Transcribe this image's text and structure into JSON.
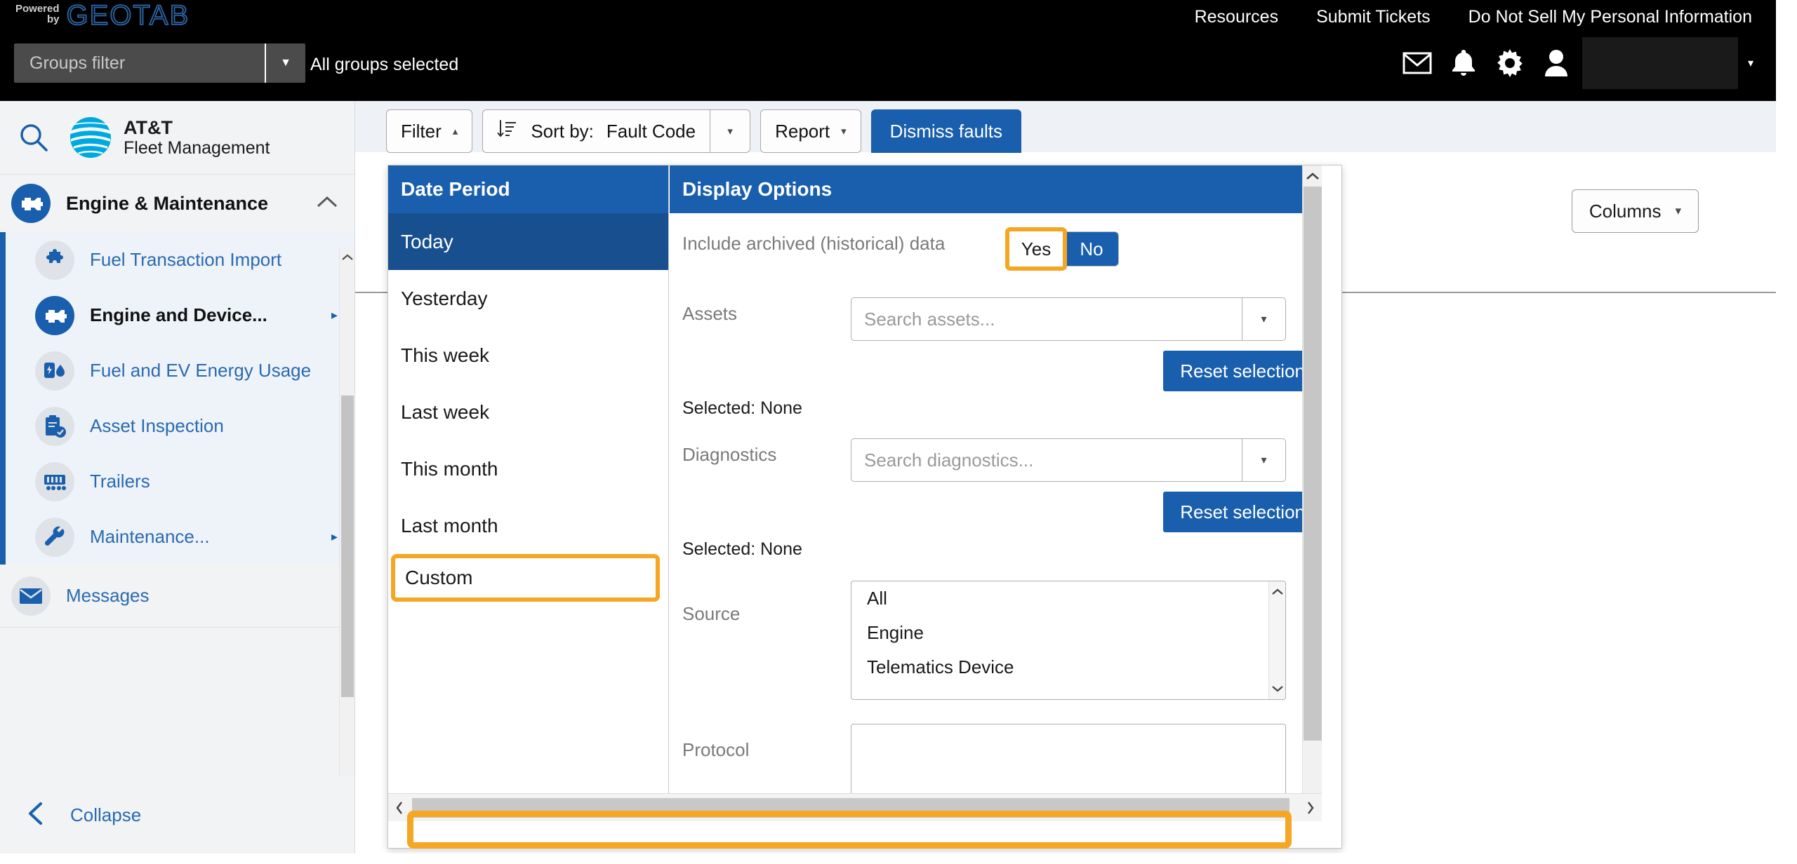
{
  "topbar": {
    "powered_line1": "Powered",
    "powered_line2": "by",
    "brand": "GEOTAB",
    "groups_filter_placeholder": "Groups filter",
    "groups_status": "All groups selected",
    "links": [
      {
        "label": "Resources",
        "name": "resources-link"
      },
      {
        "label": "Submit Tickets",
        "name": "submit-tickets-link"
      },
      {
        "label": "Do Not Sell My Personal Information",
        "name": "do-not-sell-link"
      }
    ],
    "icons": [
      {
        "name": "mail-icon",
        "glyph": "envelope"
      },
      {
        "name": "bell-icon",
        "glyph": "bell"
      },
      {
        "name": "gear-icon",
        "glyph": "gear"
      },
      {
        "name": "user-icon",
        "glyph": "person"
      }
    ],
    "user_caret": "▾"
  },
  "sidebar": {
    "product_name_line1": "AT&T",
    "product_name_line2": "Fleet Management",
    "group": {
      "label": "Engine & Maintenance",
      "icon": "engine-icon",
      "chevron": "⌃"
    },
    "items": [
      {
        "label": "Fuel Transaction Import",
        "icon": "puzzle-icon",
        "arrow": "",
        "bold": false
      },
      {
        "label": "Engine and Device...",
        "icon": "engine-icon",
        "arrow": "▸",
        "bold": true
      },
      {
        "label": "Fuel and EV Energy Usage",
        "icon": "fuel-ev-icon",
        "arrow": "",
        "bold": false
      },
      {
        "label": "Asset Inspection",
        "icon": "clipboard-check-icon",
        "arrow": "",
        "bold": false
      },
      {
        "label": "Trailers",
        "icon": "trailer-icon",
        "arrow": "",
        "bold": false
      },
      {
        "label": "Maintenance...",
        "icon": "wrench-icon",
        "arrow": "▸",
        "bold": false
      }
    ],
    "messages": {
      "label": "Messages",
      "icon": "envelope-icon"
    },
    "collapse": {
      "label": "Collapse",
      "icon": "chevron-left-icon"
    }
  },
  "toolbar": {
    "filter_label": "Filter",
    "filter_caret": "▴",
    "sort_label": "Sort by:",
    "sort_value": "Fault Code",
    "sort_caret": "▾",
    "report_label": "Report",
    "report_caret": "▾",
    "dismiss_label": "Dismiss faults",
    "columns_label": "Columns",
    "columns_caret": "▾"
  },
  "filter_panel": {
    "date_period": {
      "header": "Date Period",
      "options": [
        {
          "label": "Today",
          "state": "active"
        },
        {
          "label": "Yesterday",
          "state": "normal"
        },
        {
          "label": "This week",
          "state": "normal"
        },
        {
          "label": "Last week",
          "state": "normal"
        },
        {
          "label": "This month",
          "state": "normal"
        },
        {
          "label": "Last month",
          "state": "normal"
        },
        {
          "label": "Custom",
          "state": "highlight"
        }
      ]
    },
    "display_options": {
      "header": "Display Options",
      "archived": {
        "label": "Include archived (historical) data",
        "yes": "Yes",
        "no": "No",
        "selected": "No"
      },
      "assets": {
        "label": "Assets",
        "placeholder": "Search assets...",
        "reset": "Reset selection",
        "selected": "Selected: None",
        "caret": "▾"
      },
      "diagnostics": {
        "label": "Diagnostics",
        "placeholder": "Search diagnostics...",
        "reset": "Reset selection",
        "selected": "Selected: None",
        "caret": "▾"
      },
      "source": {
        "label": "Source",
        "options": [
          "All",
          "Engine",
          "Telematics Device"
        ]
      },
      "protocol": {
        "label": "Protocol"
      }
    }
  },
  "colors": {
    "brand_blue": "#1a5fad",
    "highlight_orange": "#f5a623",
    "active_navy": "#174f8f",
    "topbar_black": "#000000",
    "sidebar_bg": "#f1f3f5"
  }
}
